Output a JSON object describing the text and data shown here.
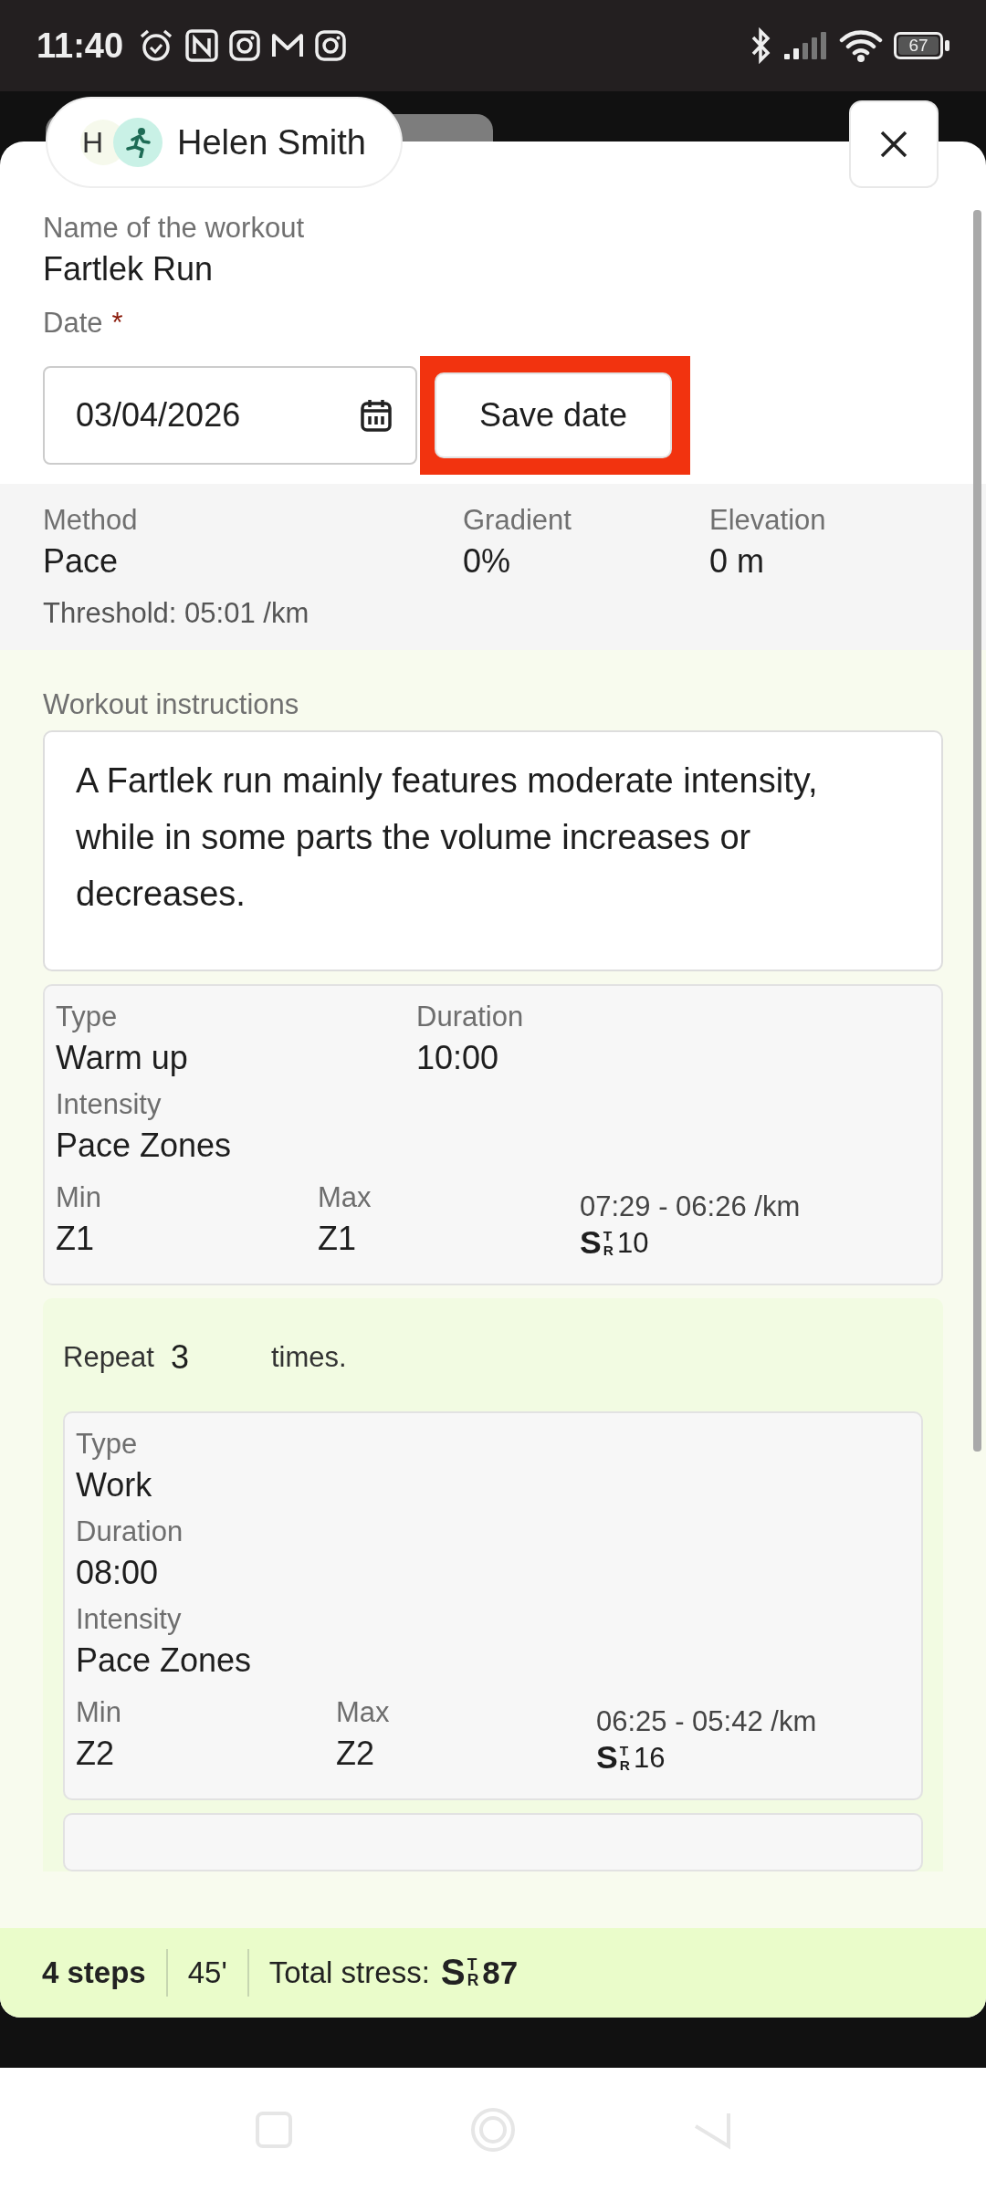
{
  "status_bar": {
    "time": "11:40",
    "battery": "67"
  },
  "header": {
    "initials": "H",
    "name": "Helen Smith"
  },
  "workout": {
    "name_label": "Name of the workout",
    "name": "Fartlek Run",
    "date_label": "Date",
    "required_mark": "*",
    "date": "03/04/2026",
    "save_button": {
      "label": "Save date",
      "highlighted": true
    }
  },
  "summary": [
    {
      "label": "Method",
      "value": "Pace"
    },
    {
      "label": "Gradient",
      "value": "0%"
    },
    {
      "label": "Elevation",
      "value": "0 m"
    }
  ],
  "threshold": "Threshold: 05:01 /km",
  "instructions": {
    "label": "Workout instructions",
    "text": "A Fartlek run mainly features moderate intensity, while in some parts the volume increases or decreases."
  },
  "steps": [
    {
      "kind": "step",
      "type_label": "Type",
      "type": "Warm up",
      "duration_label": "Duration",
      "duration": "10:00",
      "intensity_label": "Intensity",
      "intensity": "Pace Zones",
      "min_label": "Min",
      "min": "Z1",
      "max_label": "Max",
      "max": "Z1",
      "range": "07:29 - 06:26 /km",
      "stress": {
        "s": "S",
        "t": "T",
        "r": "R",
        "value": "10"
      }
    },
    {
      "kind": "repeat",
      "before": "Repeat",
      "count": "3",
      "after": "times.",
      "children": [
        {
          "kind": "step",
          "type_label": "Type",
          "type": "Work",
          "duration_label": "Duration",
          "duration": "08:00",
          "intensity_label": "Intensity",
          "intensity": "Pace Zones",
          "min_label": "Min",
          "min": "Z2",
          "max_label": "Max",
          "max": "Z2",
          "range": "06:25 - 05:42 /km",
          "stress": {
            "s": "S",
            "t": "T",
            "r": "R",
            "value": "16"
          }
        },
        {
          "kind": "step-hidden"
        }
      ]
    }
  ],
  "footer": {
    "steps": "4 steps",
    "time": "45'",
    "stress_label": "Total stress:",
    "stress": {
      "s": "S",
      "t": "T",
      "r": "R",
      "value": "87"
    }
  }
}
